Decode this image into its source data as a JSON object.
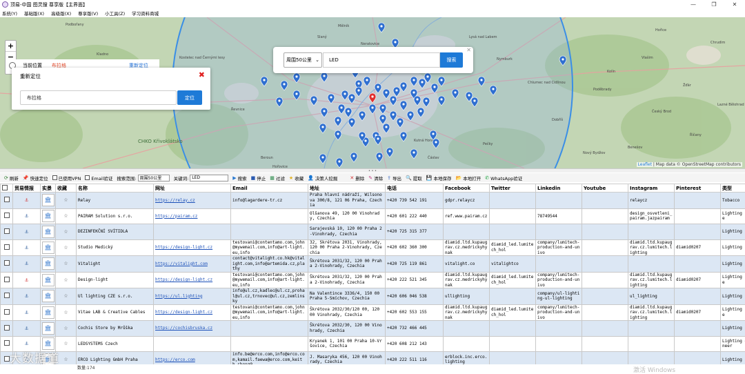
{
  "window": {
    "title": "顶易-中国 图灵搜 尊享版【主界面】",
    "controls": [
      "—",
      "❐",
      "✕"
    ]
  },
  "menu": [
    "系统(Y)",
    "基础版(X)",
    "高级版(X)",
    "尊享版(V)",
    "小工具(Z)",
    "学习资料商城"
  ],
  "map": {
    "zoom": [
      "+",
      "−",
      "⤧"
    ],
    "location_panel": {
      "label": "当前位置",
      "city": "布拉格",
      "action": "重新定位"
    },
    "relocate_dialog": {
      "title": "重新定位",
      "input_value": "布拉格",
      "button": "定位",
      "close": "✖"
    },
    "search_popup": {
      "range": "周围50公里",
      "keyword": "LED",
      "button": "搜索",
      "close": "✕"
    },
    "attribution": {
      "leaflet": "Leaflet",
      "rest": " | Map data © OpenStreetMap contributors"
    },
    "labels": [
      "Podbořany",
      "Kladno",
      "CHKO Křivoklátsko",
      "Beroun",
      "Řevnice",
      "Mělník",
      "Neratovice",
      "Brandýs nad Labem",
      "Lysá nad Labem",
      "Nymburk",
      "Poděbrady",
      "Kolín",
      "Český Brod",
      "Říčany",
      "Benešov",
      "Nový Bydžov",
      "Chlumec nad Cidlinou",
      "Kutná Hora",
      "Čáslav",
      "Pečky",
      "Kostelec nad Černými lesy",
      "Hořovice",
      "Lazné Bělohrad",
      "Chrudim",
      "Žďár",
      "Vlašim",
      "Dobříš",
      "Slaný",
      "Roudnice",
      "Hořice"
    ],
    "range_circle": "50 km"
  },
  "toolbar": {
    "refresh": "刷新",
    "quick_locate": "快速定位",
    "vpn": "已使用VPN",
    "email_verify": "Email验证",
    "range_label": "搜索范围:",
    "range_value": "周围50公里",
    "keyword_label": "关键词:",
    "keyword_value": "LED",
    "search": "搜索",
    "stop": "停止",
    "filter": "过滤",
    "favorite": "收藏",
    "decision_maker": "决策人挖掘",
    "delete": "删除",
    "clear": "清除",
    "export": "导出",
    "extract": "提取",
    "save_local": "本地保存",
    "open_local": "本地打开",
    "whatsapp": "WhatsApp验证"
  },
  "table": {
    "headers": [
      "",
      "贸易情报",
      "实景",
      "收藏",
      "名称",
      "网址",
      "Email",
      "地址",
      "电话",
      "Facebook",
      "Twitter",
      "Linkedin",
      "Youtube",
      "Instagram",
      "Pinterest",
      "类型"
    ],
    "rows": [
      {
        "name": "Relay",
        "web": "https://relay.cz",
        "email": "info@lagardere-tr.cz",
        "addr": "Praha hlavní nádraží, Wilsonova 300/8, 121 06 Praha, Czechia",
        "phone": "+420 739 542 191",
        "fb": "gdpr.relaycz",
        "tw": "",
        "li": "",
        "yt": "",
        "ig": "relaycz",
        "pi": "",
        "type": "Tobacco",
        "red": true
      },
      {
        "name": "PAIRAM Solution s.r.o.",
        "web": "https://pairam.cz",
        "email": "",
        "addr": "Olšanova 49, 120 00 Vinohrady, Czechia",
        "phone": "+420 601 222 440",
        "fb": "ref.www.pairam.cz",
        "tw": "",
        "li": "78749544",
        "yt": "",
        "ig": "design_osvetleni_pairam.jazpairam",
        "pi": "",
        "type": "Lighting store",
        "red": false
      },
      {
        "name": "DEZINFEKČNÍ SVÍTIDLA",
        "web": "",
        "email": "",
        "addr": "Sarajevská 10, 120 00 Praha 2-Vinohrady, Czechia",
        "phone": "+420 725 315 377",
        "fb": "",
        "tw": "",
        "li": "",
        "yt": "",
        "ig": "",
        "pi": "",
        "type": "Lighting",
        "red": false
      },
      {
        "name": "Studio Medický",
        "web": "https://design-light.cz",
        "email": "testovani@contentamo.com,john@mywemail.com,info@art-light.eu,info",
        "addr": "32, Škrétova 2031, Vinohrady, 120 00 Praha 2-Vinohrady, Czechia",
        "phone": "+420 602 360 300",
        "fb": "diamid.ltd.kupaugrav.cz.medrickyhynak",
        "tw": "diamid_led.lumitech_hol",
        "li": "company/lumitech-production-and-univo",
        "yt": "",
        "ig": "diamid.ltd.kupaugrav.cz.lumitech.lighting",
        "pi": "diamid0207",
        "type": "Lighting",
        "red": false
      },
      {
        "name": "Vitalight",
        "web": "https://vitalight.com",
        "email": "contact@vitalight.co.hk@vitalight.com,info@artemida.cz,plathy",
        "addr": "Škrétova 2031/32, 120 00 Praha 2-Vinohrady, Czechia",
        "phone": "+420 725 119 861",
        "fb": "vitalight.co",
        "tw": "vitalightco",
        "li": "",
        "yt": "",
        "ig": "",
        "pi": "",
        "type": "Lighting",
        "red": false
      },
      {
        "name": "Design-light",
        "web": "https://design-light.cz",
        "email": "testovani@contentamo.com,john@mywemail.com,info@art-light.eu,info",
        "addr": "Škrétova 2031/32, 120 00 Praha 2-Vinohrady, Czechia",
        "phone": "+420 222 521 345",
        "fb": "diamid.ltd.kupaugrav.cz.medrickyhynak",
        "tw": "diamid_led.lumitech_hol",
        "li": "company/lumitech-production-and-univo",
        "yt": "",
        "ig": "diamid.ltd.kupaugrav.cz.lumitech.lighting",
        "pi": "diamid0207",
        "type": "Lighting store",
        "red": true
      },
      {
        "name": "Ul lighting CZE s.r.o.",
        "web": "https://ul.lighting",
        "email": "info@ul.cz,kadlec@ul.cz,prohal@ul.cz,trnovec@ul.cz,zemlinsky",
        "addr": "Na Valentince 3336/4, 150 00 Praha 5-Smíchov, Czechia",
        "phone": "+420 606 046 538",
        "fb": "ullighting",
        "tw": "",
        "li": "company/ul-lighting-ul-lighting",
        "yt": "",
        "ig": "ul_lighting",
        "pi": "",
        "type": "Lighting",
        "red": false
      },
      {
        "name": "Vitae LAB & Creative Cables",
        "web": "https://design-light.cz",
        "email": "testovani@contentamo.com,john@mywemail.com,info@art-light.eu,info",
        "addr": "Škrétova 2032/30/120 00, 120 00 Vinohrady, Czechia",
        "phone": "+420 602 553 155",
        "fb": "diamid.ltd.kupaugrav.cz.medrickyhynak",
        "tw": "diamid_led.lumitech_hol",
        "li": "company/lumitech-production-and-univo",
        "yt": "",
        "ig": "diamid.ltd.kupaugrav.cz.lumitech.lighting",
        "pi": "diamid0207",
        "type": "Lighting store",
        "red": false
      },
      {
        "name": "Cochis Store by Mrůška",
        "web": "https://cochisbruska.cz",
        "email": "",
        "addr": "Škrétova 2032/30, 120 00 Vinohrady, Czechia",
        "phone": "+420 732 466 445",
        "fb": "",
        "tw": "",
        "li": "",
        "yt": "",
        "ig": "",
        "pi": "",
        "type": "Lighting",
        "red": false
      },
      {
        "name": "LEDSYSTEMS Czech",
        "web": "",
        "email": "",
        "addr": "Kryanek 1, 101 00 Praha 10-Vršovice, Czechia",
        "phone": "+420 608 212 143",
        "fb": "",
        "tw": "",
        "li": "",
        "yt": "",
        "ig": "",
        "pi": "",
        "type": "Lighting engineer",
        "red": false
      },
      {
        "name": "ERCO Lighting GmbH Praha",
        "web": "https://erco.com",
        "email": "info.be@erco.com,info@erco.com,kamail.faewa@erco.com,keith.sheng@",
        "addr": "J. Masaryka 456, 120 00 Vinohrady, Czechia",
        "phone": "+420 222 511 116",
        "fb": "erblock.inc.erco.lighting",
        "tw": "",
        "li": "",
        "yt": "",
        "ig": "",
        "pi": "",
        "type": "Lighting",
        "red": false
      }
    ]
  },
  "status": {
    "count": "数量:174"
  },
  "watermark": "大数据道",
  "windows_watermark": "激活 Windows",
  "colors": {
    "accent": "#1e7ad7",
    "row_alt": "#dce7f4",
    "marker": "#2f6fd0",
    "marker_active": "#e03030",
    "circle": "#3a8ee6"
  }
}
